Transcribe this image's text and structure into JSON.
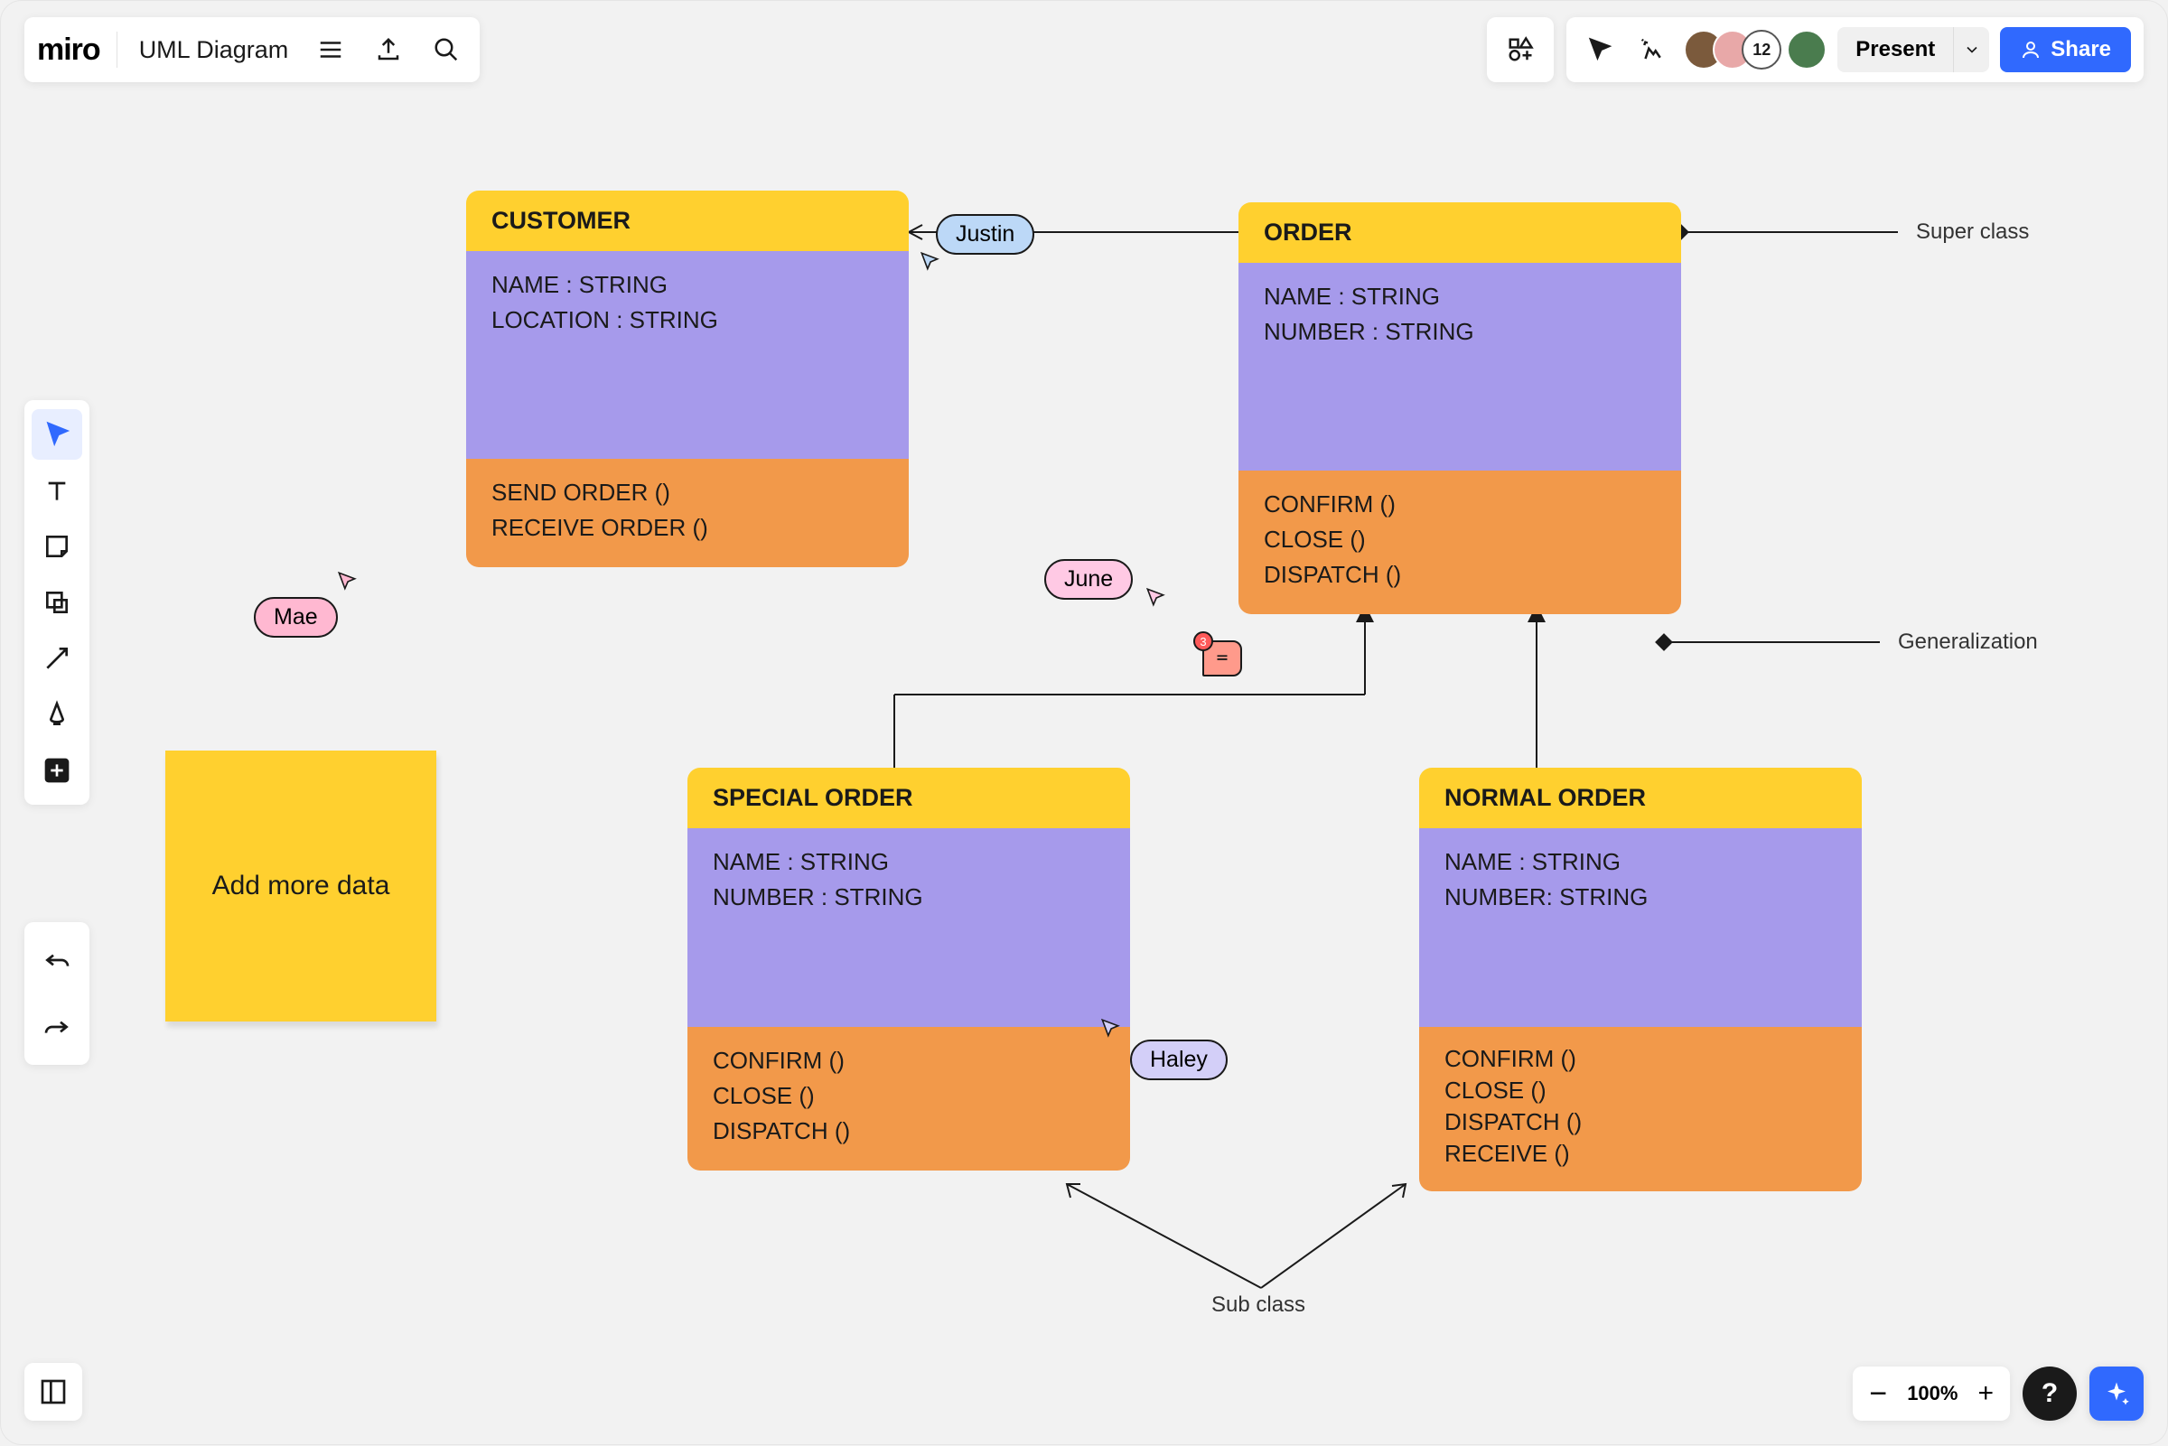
{
  "header": {
    "logo": "miro",
    "board_name": "UML Diagram",
    "present_label": "Present",
    "share_label": "Share",
    "overflow_users": "12"
  },
  "zoom": {
    "level": "100%",
    "help": "?"
  },
  "sticky": {
    "text": "Add more data"
  },
  "cursors": {
    "mae": {
      "name": "Mae",
      "color_bg": "#FFB8D1",
      "color_arrow": "#F06C9B"
    },
    "justin": {
      "name": "Justin",
      "color_bg": "#BCD8F7",
      "color_arrow": "#4094E4"
    },
    "june": {
      "name": "June",
      "color_bg": "#FFC9E4",
      "color_arrow": "#E83D95"
    },
    "haley": {
      "name": "Haley",
      "color_bg": "#D3CFF8",
      "color_arrow": "#6B5CE0"
    }
  },
  "labels": {
    "super_class": "Super class",
    "generalization": "Generalization",
    "sub_class": "Sub class"
  },
  "comment_count": "3",
  "uml": {
    "customer": {
      "title": "CUSTOMER",
      "attrs": [
        "NAME : STRING",
        "LOCATION : STRING"
      ],
      "ops": [
        "SEND ORDER ()",
        "RECEIVE ORDER ()"
      ]
    },
    "order": {
      "title": "ORDER",
      "attrs": [
        "NAME : STRING",
        "NUMBER : STRING"
      ],
      "ops": [
        "CONFIRM ()",
        "CLOSE ()",
        "DISPATCH ()"
      ]
    },
    "special": {
      "title": "SPECIAL ORDER",
      "attrs": [
        "NAME : STRING",
        "NUMBER : STRING"
      ],
      "ops": [
        "CONFIRM ()",
        "CLOSE ()",
        "DISPATCH ()"
      ]
    },
    "normal": {
      "title": "NORMAL ORDER",
      "attrs": [
        "NAME : STRING",
        "NUMBER: STRING"
      ],
      "ops": [
        "CONFIRM ()",
        "CLOSE ()",
        "DISPATCH ()",
        "RECEIVE ()"
      ]
    }
  }
}
